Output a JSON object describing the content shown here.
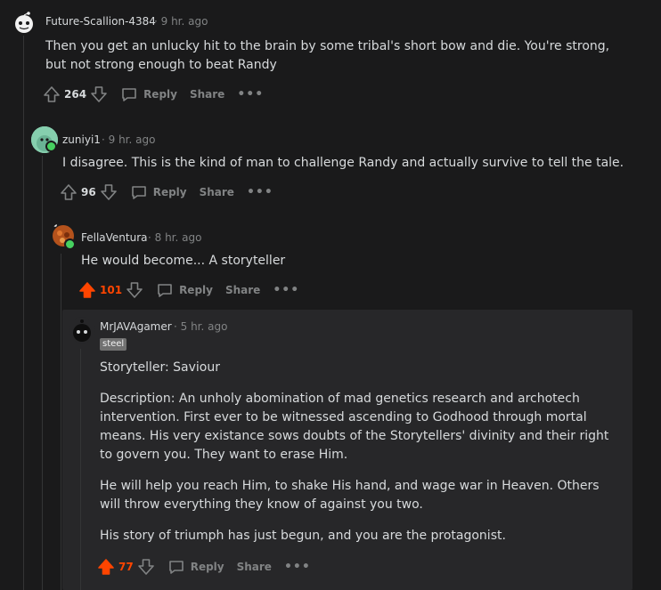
{
  "comments": [
    {
      "username": "Future-Scallion-4384",
      "time": "· 9 hr. ago",
      "paragraphs": [
        "Then you get an unlucky hit to the brain by some tribal's short bow and die. You're strong, but not strong enough to beat Randy"
      ],
      "score": "264",
      "reply_label": "Reply",
      "share_label": "Share",
      "more_label": "•••"
    },
    {
      "username": "zuniyi1",
      "time": "· 9 hr. ago",
      "paragraphs": [
        "I disagree. This is the kind of man to challenge Randy and actually survive to tell the tale."
      ],
      "score": "96",
      "reply_label": "Reply",
      "share_label": "Share",
      "more_label": "•••"
    },
    {
      "username": "FellaVentura",
      "time": "· 8 hr. ago",
      "paragraphs": [
        "He would become... A storyteller"
      ],
      "score": "101",
      "reply_label": "Reply",
      "share_label": "Share",
      "more_label": "•••"
    },
    {
      "username": "MrJAVAgamer",
      "time": "· 5 hr. ago",
      "flair": "steel",
      "paragraphs": [
        "Storyteller: Saviour",
        "Description: An unholy abomination of mad genetics research and archotech intervention. First ever to be witnessed ascending to Godhood through mortal means. His very existance sows doubts of the Storytellers' divinity and their right to govern you. They want to erase Him.",
        "He will help you reach Him, to shake His hand, and wage war in Heaven. Others will throw everything they know of against you two.",
        "His story of triumph has just begun, and you are the protagonist."
      ],
      "score": "77",
      "reply_label": "Reply",
      "share_label": "Share",
      "more_label": "•••"
    }
  ],
  "colors": {
    "background": "#1a1a1b",
    "panel": "#272729",
    "upvoted": "#ff4500",
    "muted": "#818384",
    "text": "#d7dadc",
    "online": "#46d160"
  },
  "icons": [
    "upvote-icon",
    "downvote-icon",
    "comment-icon",
    "more-icon",
    "online-indicator"
  ]
}
